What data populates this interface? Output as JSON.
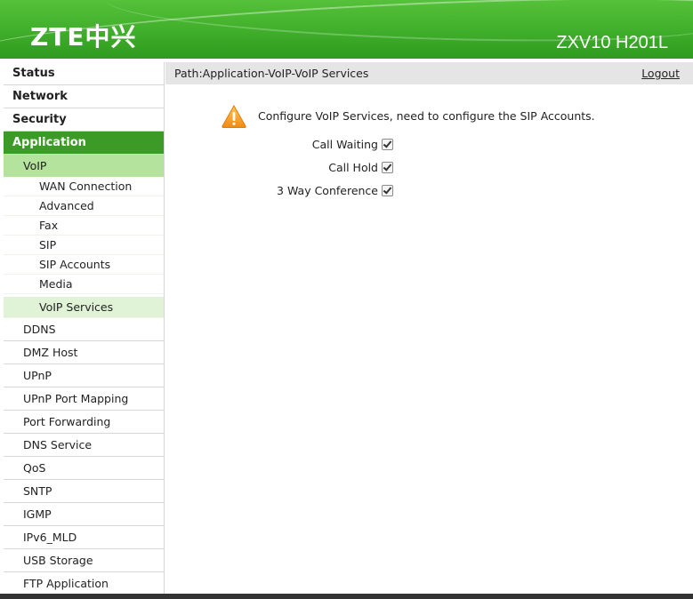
{
  "header": {
    "logo_text": "ZTE中兴",
    "model": "ZXV10 H201L"
  },
  "pathbar": {
    "path": "Path:Application-VoIP-VoIP Services",
    "logout": "Logout"
  },
  "sidebar": {
    "top": [
      "Status",
      "Network",
      "Security",
      "Application"
    ],
    "voip_label": "VoIP",
    "voip_items": [
      "WAN Connection",
      "Advanced",
      "Fax",
      "SIP",
      "SIP Accounts",
      "Media",
      "VoIP Services"
    ],
    "app_items": [
      "DDNS",
      "DMZ Host",
      "UPnP",
      "UPnP Port Mapping",
      "Port Forwarding",
      "DNS Service",
      "QoS",
      "SNTP",
      "IGMP",
      "IPv6_MLD",
      "USB Storage",
      "FTP Application"
    ]
  },
  "content": {
    "notice": "Configure VoIP Services, need to configure the SIP Accounts.",
    "options": [
      {
        "label": "Call Waiting",
        "checked": true
      },
      {
        "label": "Call Hold",
        "checked": true
      },
      {
        "label": "3 Way Conference",
        "checked": true
      }
    ]
  },
  "colors": {
    "brand_green": "#3b9b26",
    "active_sub": "#b3e39c",
    "active_leaf": "#e0f3d6",
    "warning": "#f5a623"
  }
}
